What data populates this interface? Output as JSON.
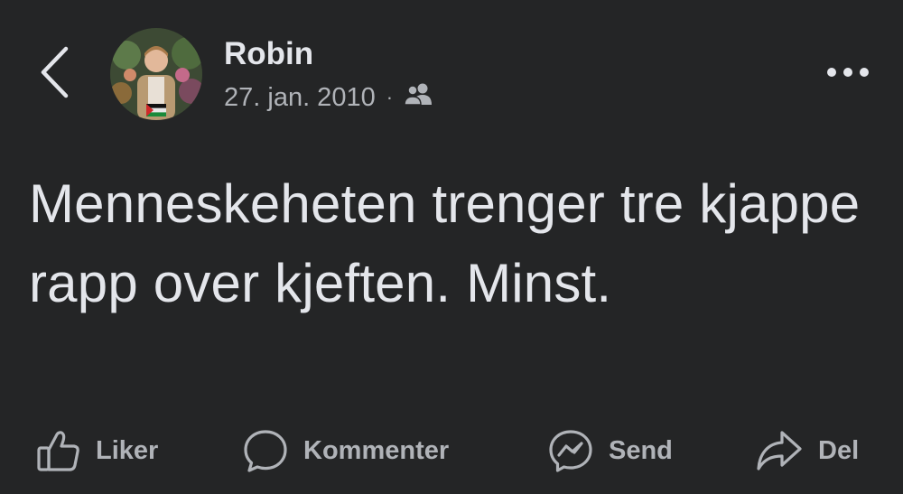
{
  "header": {
    "back_icon": "chevron-left-icon",
    "author_name": "Robin",
    "date": "27. jan. 2010",
    "separator": "·",
    "audience_icon": "friends-icon",
    "more_icon": "more-horizontal-icon"
  },
  "post": {
    "text": "Menneskeheten trenger tre kjappe rapp over kjeften. Minst."
  },
  "actions": {
    "like_label": "Liker",
    "like_icon": "thumbs-up-icon",
    "comment_label": "Kommenter",
    "comment_icon": "comment-bubble-icon",
    "send_label": "Send",
    "send_icon": "messenger-icon",
    "share_label": "Del",
    "share_icon": "share-arrow-icon"
  },
  "colors": {
    "background": "#242526",
    "primary_text": "#e4e6eb",
    "secondary_text": "#b0b3b8"
  }
}
